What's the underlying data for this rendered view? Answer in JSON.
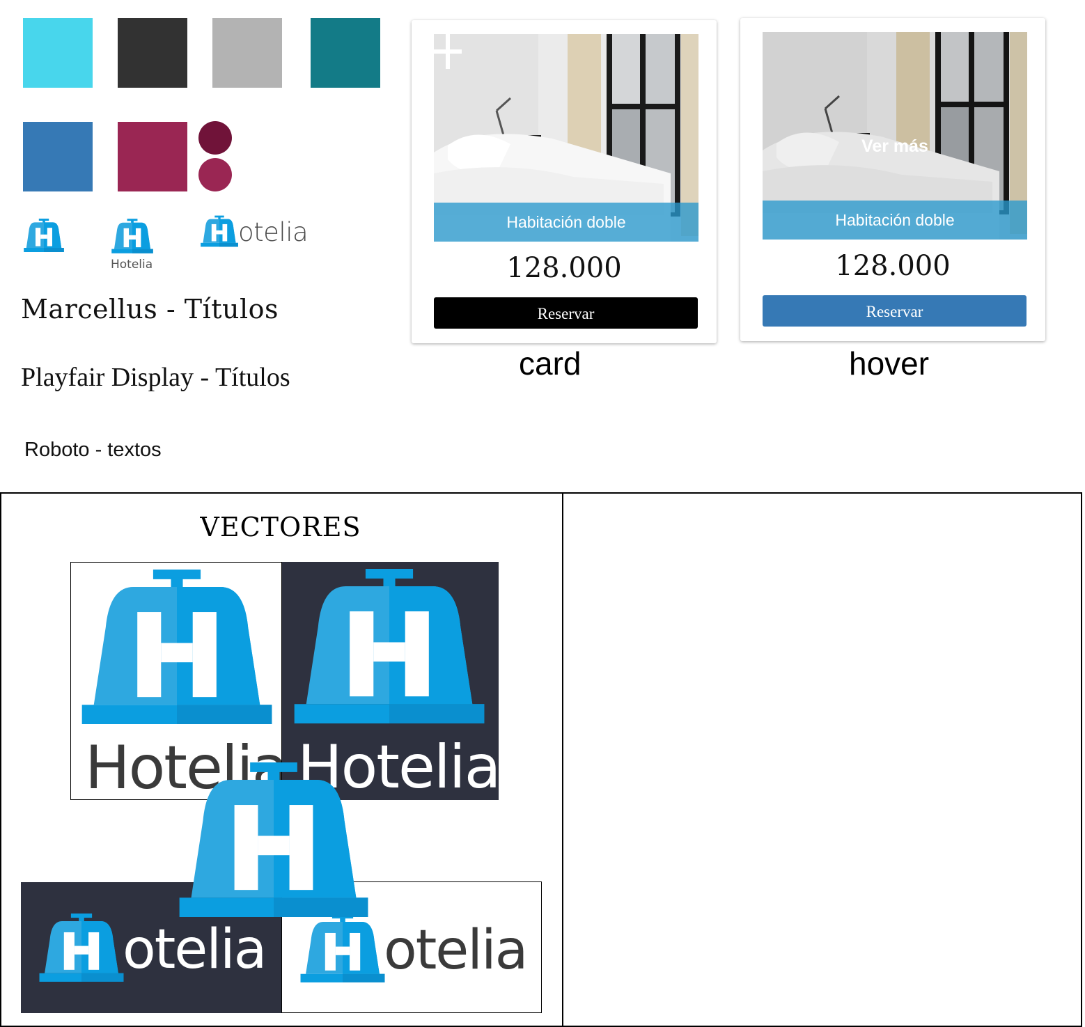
{
  "palette": {
    "swatches": [
      "#48d6ec",
      "#323232",
      "#b3b3b3",
      "#137b87",
      "#3679b5",
      "#9a2653"
    ],
    "dots": [
      "#701339",
      "#9a2653"
    ]
  },
  "small_logos": {
    "logo_caption": "Hotelia",
    "wordmark_text": "otelia"
  },
  "fonts": {
    "marcellus": "Marcellus - Títulos",
    "playfair": "Playfair Display - Títulos",
    "roboto": "Roboto - textos"
  },
  "card": {
    "caption": "Habitación doble",
    "price": "128.000",
    "button_label": "Reservar",
    "button_color": "#000000",
    "label": "card"
  },
  "hover_card": {
    "overlay_text": "Ver más",
    "caption": "Habitación doble",
    "price": "128.000",
    "button_label": "Reservar",
    "button_color": "#3679b5",
    "label": "hover"
  },
  "vectores": {
    "title": "VECTORES",
    "wordmark_full": "Hotelia",
    "wordmark_short": "otelia",
    "brand_blue": "#2ea8e0",
    "dark_bg": "#2e313f"
  }
}
